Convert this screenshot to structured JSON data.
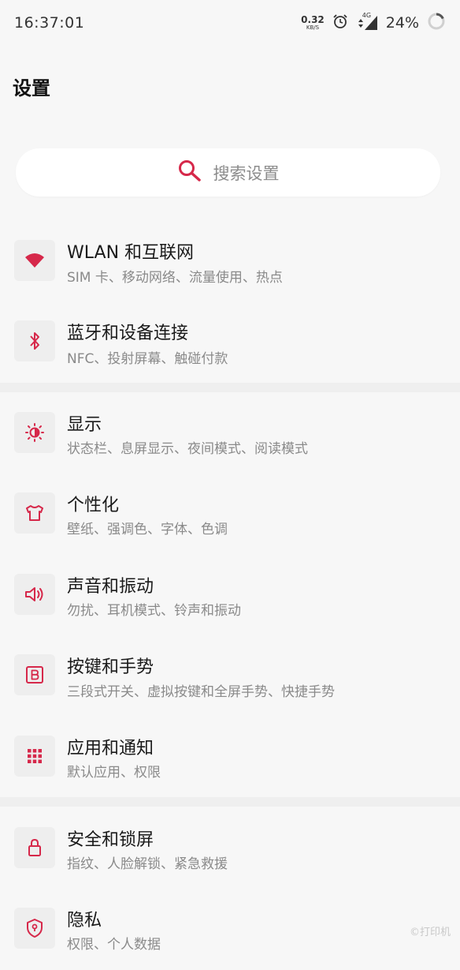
{
  "status_bar": {
    "time": "16:37:01",
    "net_speed": "0.32",
    "net_unit": "KB/S",
    "network": "4G",
    "battery": "24%",
    "icons": [
      "alarm-icon",
      "signal-icon",
      "battery-ring-icon"
    ]
  },
  "header": {
    "title": "设置"
  },
  "search": {
    "placeholder": "搜索设置",
    "icon": "search-icon"
  },
  "accent_color": "#d6284a",
  "sections": [
    {
      "items": [
        {
          "title": "WLAN 和互联网",
          "subtitle": "SIM 卡、移动网络、流量使用、热点",
          "icon": "wifi-icon"
        },
        {
          "title": "蓝牙和设备连接",
          "subtitle": "NFC、投射屏幕、触碰付款",
          "icon": "bluetooth-icon"
        }
      ]
    },
    {
      "items": [
        {
          "title": "显示",
          "subtitle": "状态栏、息屏显示、夜间模式、阅读模式",
          "icon": "brightness-icon"
        },
        {
          "title": "个性化",
          "subtitle": "壁纸、强调色、字体、色调",
          "icon": "tshirt-icon"
        },
        {
          "title": "声音和振动",
          "subtitle": "勿扰、耳机模式、铃声和振动",
          "icon": "speaker-icon"
        },
        {
          "title": "按键和手势",
          "subtitle": "三段式开关、虚拟按键和全屏手势、快捷手势",
          "icon": "button-b-icon"
        },
        {
          "title": "应用和通知",
          "subtitle": "默认应用、权限",
          "icon": "apps-grid-icon"
        }
      ]
    },
    {
      "items": [
        {
          "title": "安全和锁屏",
          "subtitle": "指纹、人脸解锁、紧急救援",
          "icon": "lock-icon"
        },
        {
          "title": "隐私",
          "subtitle": "权限、个人数据",
          "icon": "privacy-shield-icon"
        }
      ]
    }
  ],
  "watermark": "©打印机"
}
